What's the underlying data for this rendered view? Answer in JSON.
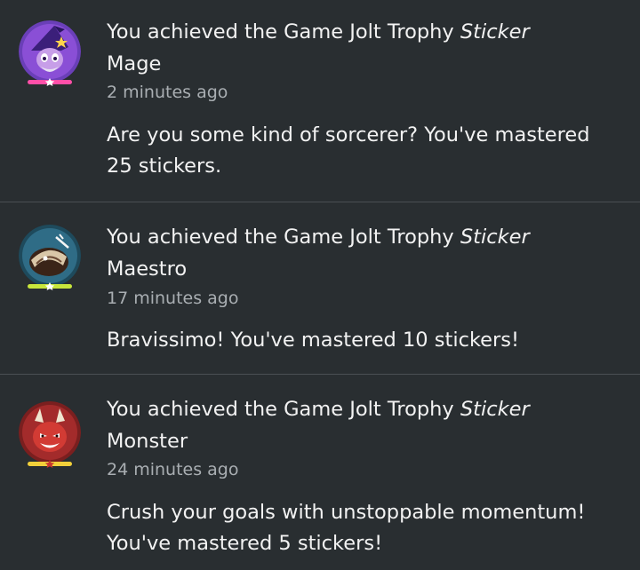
{
  "notifications": [
    {
      "title_prefix": "You achieved the Game Jolt Trophy ",
      "title_emphasis": "Sticker",
      "title_suffix": "Mage",
      "time": "2 minutes ago",
      "body_line1": "Are you some kind of sorcerer? You've mastered",
      "body_line2": "25 stickers.",
      "avatar_icon": "wizard-trophy-icon",
      "avatar_bg": "#6a3fb8",
      "bar_color": "#ff4fa8"
    },
    {
      "title_prefix": "You achieved the Game Jolt Trophy ",
      "title_emphasis": "Sticker",
      "title_suffix": "Maestro",
      "time": "17 minutes ago",
      "body_line1": "Bravissimo! You've mastered 10 stickers!",
      "body_line2": "",
      "avatar_icon": "maestro-trophy-icon",
      "avatar_bg": "#1e4a5c",
      "bar_color": "#c8e63c"
    },
    {
      "title_prefix": "You achieved the Game Jolt Trophy ",
      "title_emphasis": "Sticker",
      "title_suffix": "Monster",
      "time": "24 minutes ago",
      "body_line1": "Crush your goals with unstoppable momentum!",
      "body_line2": "You've mastered 5 stickers!",
      "avatar_icon": "monster-trophy-icon",
      "avatar_bg": "#7a1f1f",
      "bar_color": "#f2d03a"
    }
  ],
  "colors": {
    "background": "#292e31",
    "divider": "#4a4f53",
    "text": "#f2f2f2",
    "muted": "#a9aeb2"
  }
}
